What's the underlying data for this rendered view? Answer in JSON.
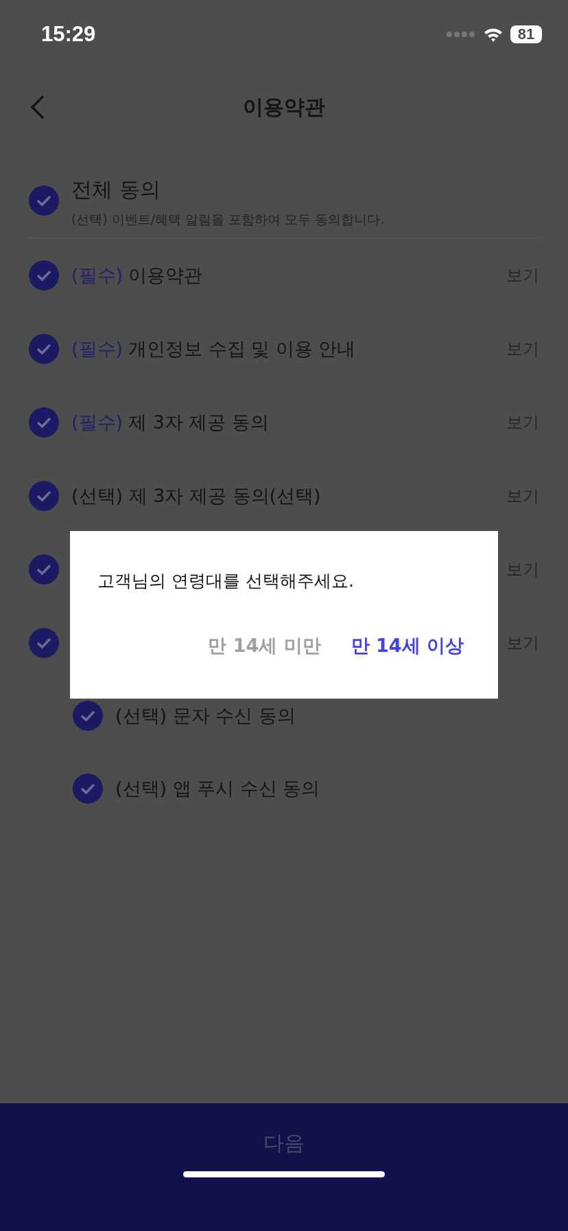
{
  "status_bar": {
    "time": "15:29",
    "battery": "81"
  },
  "header": {
    "title": "이용약관"
  },
  "agree_all": {
    "checked": true,
    "title": "전체 동의",
    "subtitle": "(선택) 이벤트/혜택 알림을 포함하여 모두 동의합니다."
  },
  "terms": [
    {
      "checked": true,
      "tag": "(필수)",
      "label": "이용약관",
      "view": "보기"
    },
    {
      "checked": true,
      "tag": "(필수)",
      "label": "개인정보 수집 및 이용 안내",
      "view": "보기"
    },
    {
      "checked": true,
      "tag": "(필수)",
      "label": "제 3자 제공 동의",
      "view": "보기"
    },
    {
      "checked": true,
      "label": "(선택) 제 3자 제공 동의(선택)",
      "view": "보기"
    },
    {
      "checked": true,
      "view": "보기"
    },
    {
      "checked": true,
      "view": "보기",
      "children": [
        {
          "checked": true,
          "label": "(선택) 문자 수신 동의"
        },
        {
          "checked": true,
          "label": "(선택) 앱 푸시 수신 동의"
        }
      ]
    }
  ],
  "dialog": {
    "message": "고객님의 연령대를 선택해주세요.",
    "buttons": [
      {
        "label": "만 14세 미만",
        "kind": "secondary"
      },
      {
        "label": "만 14세 이상",
        "kind": "primary"
      }
    ]
  },
  "next_button": {
    "label": "다음"
  }
}
